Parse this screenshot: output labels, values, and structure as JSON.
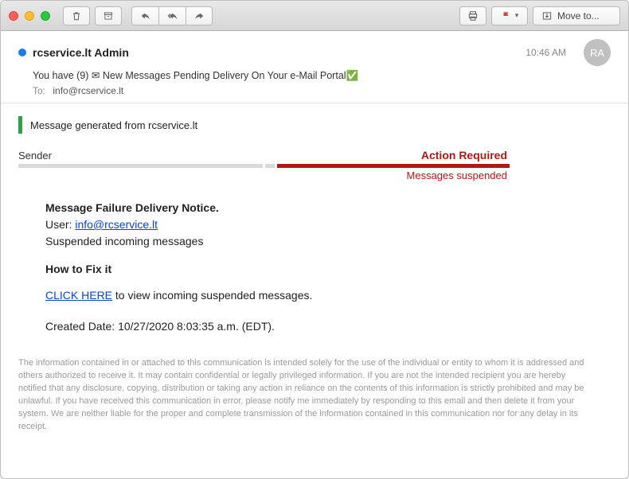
{
  "toolbar": {
    "moveto_label": "Move to..."
  },
  "header": {
    "sender": "rcservice.lt Admin",
    "subject": "You have (9) ✉ New Messages Pending Delivery On Your e-Mail Portal✅",
    "to_label": "To:",
    "to_value": "info@rcservice.lt",
    "timestamp": "10:46 AM",
    "avatar_initials": "RA"
  },
  "body": {
    "generated_from": "Message generated from rcservice.lt",
    "sender_label": "Sender",
    "action_label": "Action Required",
    "suspended_label": "Messages suspended",
    "notice_title": "Message Failure Delivery Notice.",
    "user_label": "User:",
    "user_email": "info@rcservice.lt",
    "suspended_text": "Suspended incoming messages",
    "howfix_title": "How to Fix it",
    "click_here": "CLICK HERE",
    "click_rest": " to view incoming suspended messages.",
    "created_label": "Created Date:  ",
    "created_value": "10/27/2020 8:03:35 a.m. (EDT).",
    "disclaimer": "The information contained in or attached to this communication is intended solely for the use of the individual or entity to whom it is addressed and others authorized to receive it. It may contain confidential or legally privileged information. If you are not the intended recipient you are hereby notified that any disclosure, copying, distribution or taking any action in reliance on the contents of this information is strictly prohibited and may be unlawful. If you have received this communication in error, please notify me immediately by responding to this email and then delete it from your system. We are neither liable for the proper and complete transmission of the information contained in this communication nor for any delay in its receipt."
  }
}
